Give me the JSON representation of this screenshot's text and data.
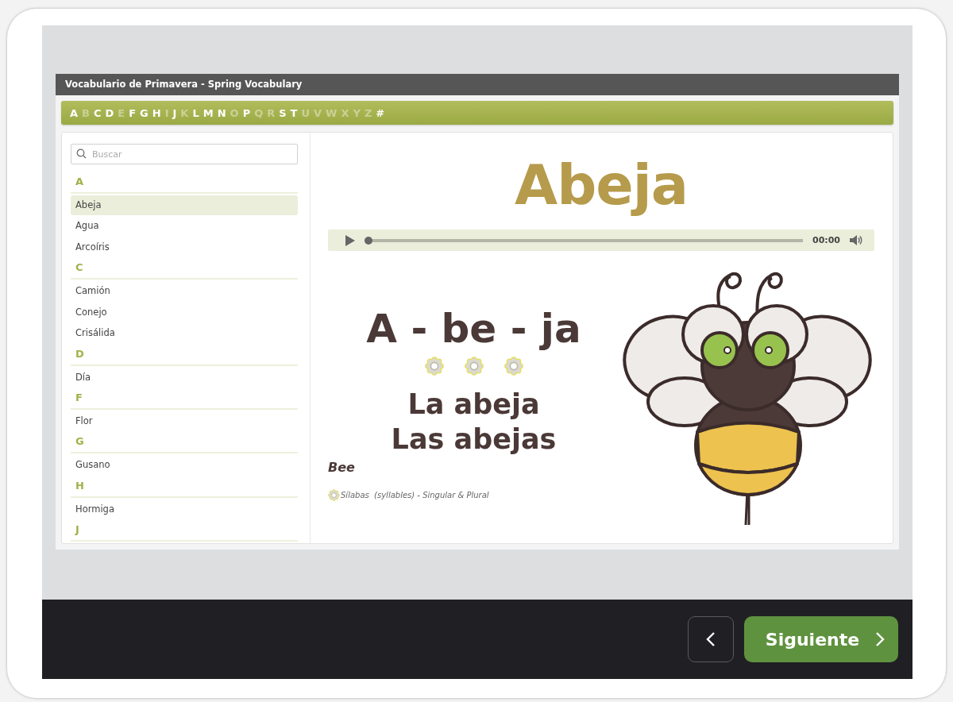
{
  "window": {
    "title": "Vocabulario de Primavera - Spring Vocabulary"
  },
  "alphabet": [
    {
      "label": "A",
      "disabled": false
    },
    {
      "label": "B",
      "disabled": true
    },
    {
      "label": "C",
      "disabled": false
    },
    {
      "label": "D",
      "disabled": false
    },
    {
      "label": "E",
      "disabled": true
    },
    {
      "label": "F",
      "disabled": false
    },
    {
      "label": "G",
      "disabled": false
    },
    {
      "label": "H",
      "disabled": false
    },
    {
      "label": "I",
      "disabled": true
    },
    {
      "label": "J",
      "disabled": false
    },
    {
      "label": "K",
      "disabled": true
    },
    {
      "label": "L",
      "disabled": false
    },
    {
      "label": "M",
      "disabled": false
    },
    {
      "label": "N",
      "disabled": false
    },
    {
      "label": "O",
      "disabled": true
    },
    {
      "label": "P",
      "disabled": false
    },
    {
      "label": "Q",
      "disabled": true
    },
    {
      "label": "R",
      "disabled": true
    },
    {
      "label": "S",
      "disabled": false
    },
    {
      "label": "T",
      "disabled": false
    },
    {
      "label": "U",
      "disabled": true
    },
    {
      "label": "V",
      "disabled": true
    },
    {
      "label": "W",
      "disabled": true
    },
    {
      "label": "X",
      "disabled": true
    },
    {
      "label": "Y",
      "disabled": true
    },
    {
      "label": "Z",
      "disabled": true
    },
    {
      "label": "#",
      "disabled": false
    }
  ],
  "search": {
    "placeholder": "Buscar"
  },
  "word_list": [
    {
      "kind": "header",
      "label": "A"
    },
    {
      "kind": "word",
      "label": "Abeja",
      "selected": true
    },
    {
      "kind": "word",
      "label": "Agua",
      "selected": false
    },
    {
      "kind": "word",
      "label": "Arcoíris",
      "selected": false
    },
    {
      "kind": "header",
      "label": "C"
    },
    {
      "kind": "word",
      "label": "Camión",
      "selected": false
    },
    {
      "kind": "word",
      "label": "Conejo",
      "selected": false
    },
    {
      "kind": "word",
      "label": "Crisálida",
      "selected": false
    },
    {
      "kind": "header",
      "label": "D"
    },
    {
      "kind": "word",
      "label": "Día",
      "selected": false
    },
    {
      "kind": "header",
      "label": "F"
    },
    {
      "kind": "word",
      "label": "Flor",
      "selected": false
    },
    {
      "kind": "header",
      "label": "G"
    },
    {
      "kind": "word",
      "label": "Gusano",
      "selected": false
    },
    {
      "kind": "header",
      "label": "H"
    },
    {
      "kind": "word",
      "label": "Hormiga",
      "selected": false
    },
    {
      "kind": "header",
      "label": "J"
    }
  ],
  "entry": {
    "title": "Abeja",
    "audio": {
      "level": 0,
      "time": "00:00"
    },
    "syllables": "A - be - ja",
    "singular": "La abeja",
    "plural": "Las abejas",
    "translation": "Bee",
    "legend": "Sílabas  (syllables) - Singular & Plural"
  },
  "nav": {
    "next": "Siguiente"
  }
}
